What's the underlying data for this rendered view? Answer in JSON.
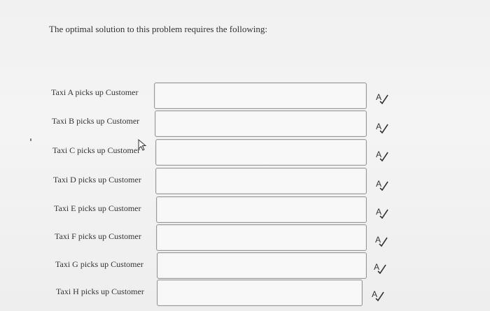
{
  "question": {
    "prompt": "The optimal solution to this problem requires the following:"
  },
  "rows": [
    {
      "label": "Taxi A picks up Customer",
      "value": ""
    },
    {
      "label": "Taxi B picks up Customer",
      "value": ""
    },
    {
      "label": "Taxi C picks up Customer",
      "value": ""
    },
    {
      "label": "Taxi D picks up Customer",
      "value": ""
    },
    {
      "label": "Taxi E picks up Customer",
      "value": ""
    },
    {
      "label": "Taxi F picks up Customer",
      "value": ""
    },
    {
      "label": "Taxi G picks up Customer",
      "value": ""
    },
    {
      "label": "Taxi H picks up Customer",
      "value": ""
    }
  ],
  "icons": {
    "spellcheck": "spellcheck-icon",
    "cursor": "mouse-pointer-icon"
  },
  "colors": {
    "background": "#f2f2f2",
    "box_border": "#9a9a9a",
    "text": "#333333"
  }
}
